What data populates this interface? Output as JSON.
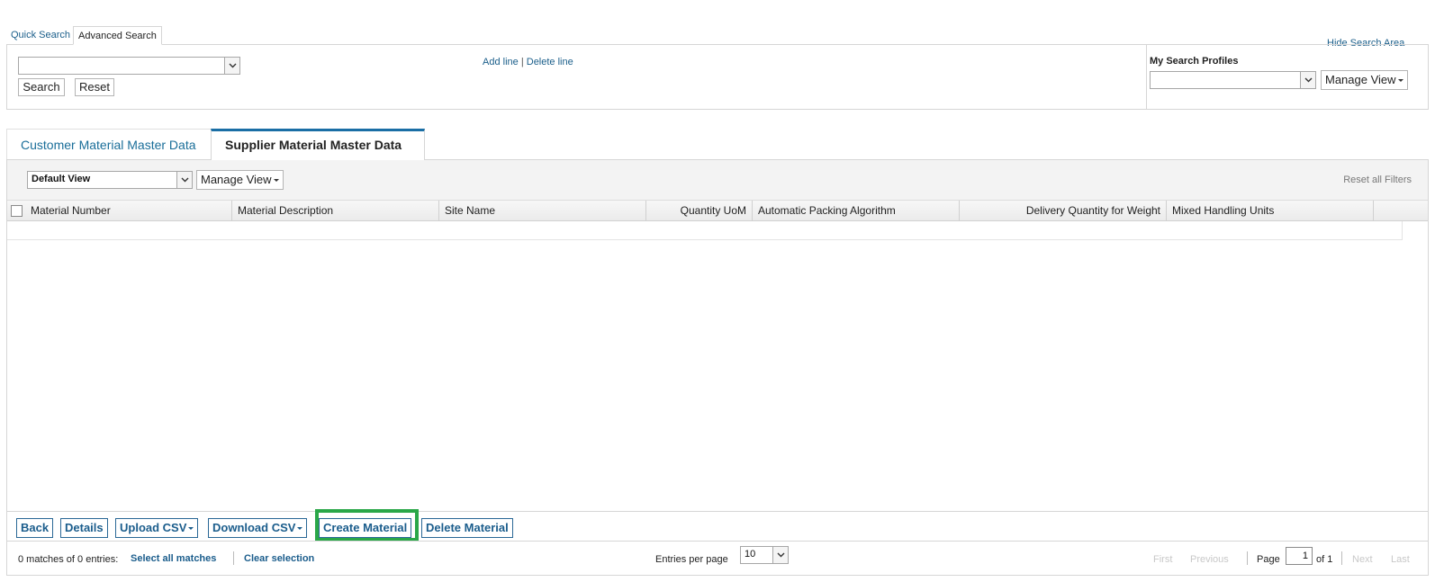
{
  "search": {
    "quick_tab": "Quick Search",
    "advanced_tab": "Advanced Search",
    "hide_link": "Hide Search Area",
    "field_select_value": "",
    "search_button": "Search",
    "reset_button": "Reset",
    "add_line": "Add line",
    "line_separator": "|",
    "delete_line": "Delete line",
    "profiles_label": "My Search Profiles",
    "profile_select_value": "",
    "manage_view": "Manage View"
  },
  "tabs": [
    {
      "label": "Customer Material Master Data",
      "active": false
    },
    {
      "label": "Supplier Material Master Data",
      "active": true
    }
  ],
  "table_toolbar": {
    "view_select": "Default View",
    "manage_view": "Manage View",
    "reset_filters": "Reset all Filters"
  },
  "columns": [
    "Material Number",
    "Material Description",
    "Site Name",
    "Quantity UoM",
    "Automatic Packing Algorithm",
    "Delivery Quantity for Weight",
    "Mixed Handling Units"
  ],
  "rows": [],
  "actions": {
    "back": "Back",
    "details": "Details",
    "upload_csv": "Upload CSV",
    "download_csv": "Download CSV",
    "create_material": "Create Material",
    "delete_material": "Delete Material"
  },
  "footer": {
    "matches": "0 matches of 0 entries:",
    "select_all": "Select all matches",
    "clear_selection": "Clear selection",
    "entries_label": "Entries per page",
    "entries_value": "10",
    "first": "First",
    "previous": "Previous",
    "page_label": "Page",
    "page_value": "1",
    "of_label": "of 1",
    "next": "Next",
    "last": "Last"
  },
  "colors": {
    "link": "#1a5e8a",
    "active_tab_border": "#1a6ea5",
    "highlight": "#2aa748"
  }
}
